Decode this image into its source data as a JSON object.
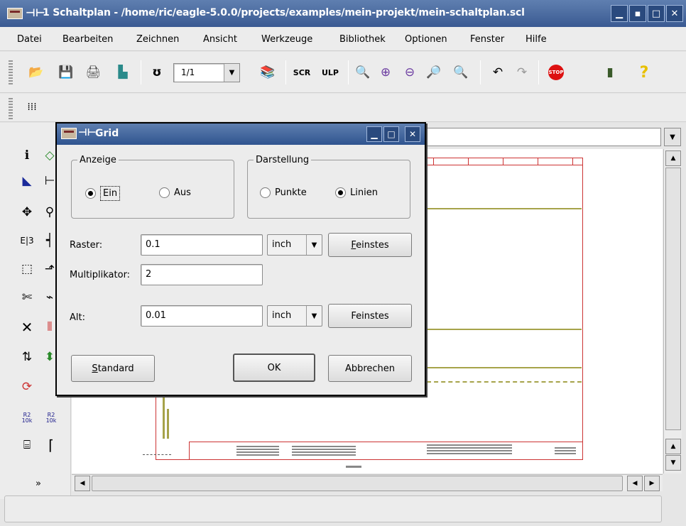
{
  "window": {
    "title": "1 Schaltplan - /home/ric/eagle-5.0.0/projects/examples/mein-projekt/mein-schaltplan.scl",
    "minimize_glyph": "▁",
    "small_glyph": "▪",
    "maximize_glyph": "□",
    "close_glyph": "✕"
  },
  "menubar": {
    "items": [
      "Datei",
      "Bearbeiten",
      "Zeichnen",
      "Ansicht",
      "Werkzeuge",
      "Bibliothek",
      "Optionen",
      "Fenster",
      "Hilfe"
    ]
  },
  "toolbar": {
    "zoom_value": "1/1",
    "icons": [
      "open-icon",
      "save-icon",
      "print-icon",
      "board-icon",
      "use-icon",
      "zoom-select",
      "library-icon",
      "script-icon",
      "ulp-icon",
      "zoom-fit-icon",
      "zoom-in-icon",
      "zoom-out-icon",
      "zoom-redraw-icon",
      "zoom-select-icon",
      "undo-icon",
      "redo-icon",
      "stop-icon",
      "go-icon",
      "help-icon"
    ]
  },
  "dialog": {
    "title": "Grid",
    "display_group": {
      "legend": "Anzeige",
      "on_label": "Ein",
      "off_label": "Aus",
      "selected": "Ein"
    },
    "style_group": {
      "legend": "Darstellung",
      "dots_label": "Punkte",
      "lines_label": "Linien",
      "selected": "Linien"
    },
    "grid_label": "Raster:",
    "grid_value": "0.1",
    "grid_unit": "inch",
    "grid_finest_label": "Feinstes",
    "multiplier_label": "Multiplikator:",
    "multiplier_value": "2",
    "alt_label": "Alt:",
    "alt_value": "0.01",
    "alt_unit": "inch",
    "alt_finest_label": "Feinstes",
    "standard_label": "Standard",
    "ok_label": "OK",
    "cancel_label": "Abbrechen",
    "minimize_glyph": "▁",
    "maximize_glyph": "□",
    "close_glyph": "✕"
  },
  "left_palette": {
    "icons": [
      "info-icon",
      "show-icon",
      "display-icon",
      "mark-icon",
      "move-icon",
      "copy-icon",
      "mirror-icon",
      "rotate-icon",
      "group-icon",
      "change-icon",
      "cut-icon",
      "paste-icon",
      "delete-icon",
      "add-icon",
      "pinswap-icon",
      "gateswap-icon",
      "replace-icon",
      "name-icon",
      "value-icon",
      "smash-icon",
      "miter-icon",
      "split-icon",
      "more-icon"
    ],
    "name_text": "R2\n10k",
    "value_text": "R2\n10k"
  }
}
